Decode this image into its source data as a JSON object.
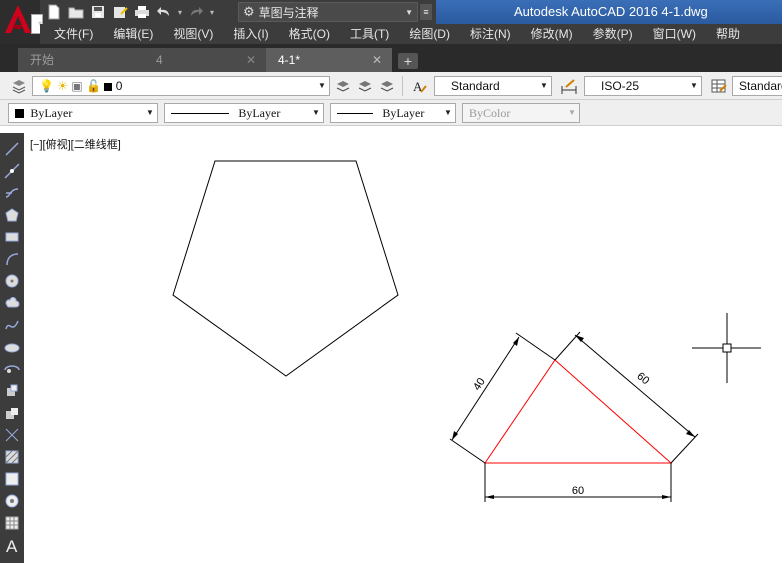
{
  "app": {
    "title": "Autodesk AutoCAD 2016    4-1.dwg",
    "workspace": "草图与注释"
  },
  "menu": [
    "文件(F)",
    "编辑(E)",
    "视图(V)",
    "插入(I)",
    "格式(O)",
    "工具(T)",
    "绘图(D)",
    "标注(N)",
    "修改(M)",
    "参数(P)",
    "窗口(W)",
    "帮助"
  ],
  "tabs": [
    {
      "label": "开始",
      "active": false
    },
    {
      "label": "4",
      "active": false,
      "closable": true
    },
    {
      "label": "4-1*",
      "active": true,
      "closable": true
    }
  ],
  "layers_toolbar": {
    "layer": "0",
    "text_style": "Standard",
    "dim_style": "ISO-25",
    "table_style": "Standard"
  },
  "properties_toolbar": {
    "color": "ByLayer",
    "linetype": "ByLayer",
    "lineweight": "ByLayer",
    "plot_style": "ByColor"
  },
  "viewport": {
    "label": "[−][俯视][二维线框]"
  },
  "drawing": {
    "dimensions": {
      "left_side": "40",
      "right_side": "60",
      "base": "60"
    },
    "colors": {
      "triangle": "#ff0000",
      "geometry": "#000000",
      "dimension": "#000000"
    }
  },
  "left_tools": [
    "line-icon",
    "construction-line-icon",
    "polyline-icon",
    "polygon-icon",
    "rectangle-icon",
    "arc-icon",
    "circle-icon",
    "revision-cloud-icon",
    "spline-icon",
    "ellipse-icon",
    "ellipse-arc-icon",
    "insert-block-icon",
    "make-block-icon",
    "point-icon",
    "hatch-icon",
    "gradient-icon",
    "region-icon",
    "table-icon",
    "multiline-text-icon"
  ]
}
